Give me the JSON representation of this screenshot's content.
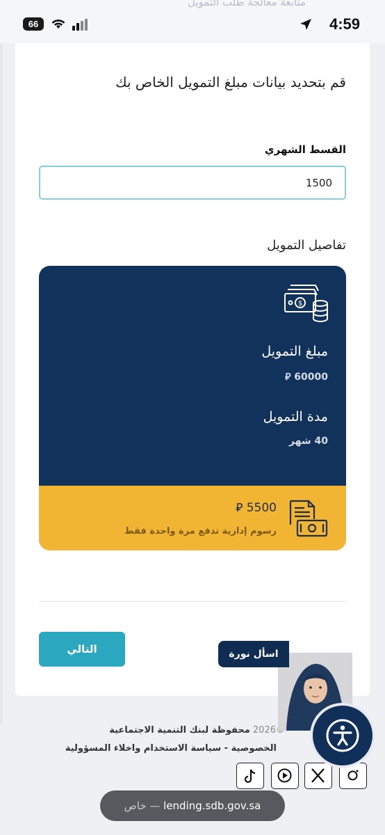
{
  "status_bar": {
    "time": "4:59",
    "battery": "66",
    "ghost_text": "متابعة معالجة طلب التمويل"
  },
  "form": {
    "heading": "قم بتحديد بيانات مبلغ التمويل الخاص بك",
    "installment_label": "القسط الشهري",
    "installment_value": "1500"
  },
  "details": {
    "title": "تفاصيل التمويل",
    "amount_label": "مبلغ التمويل",
    "amount_value": "60000 ⃁",
    "duration_label": "مدة التمويل",
    "duration_value": "40 شهر",
    "fee_amount": "5500 ⃁",
    "fee_note": "رسوم إدارية تدفع مرة واحدة فقط"
  },
  "actions": {
    "next_label": "التالي",
    "ask_label": "اسأل نورة"
  },
  "footer": {
    "copyright_year": "©2026",
    "rights_text": "محفوظة لبنك التنمية الاجتماعية",
    "links_text": "الخصوصية - سياسة الاستخدام واخلاء المسؤولية"
  },
  "browser": {
    "url": "lending.sdb.gov.sa",
    "private_label": "— خاص"
  },
  "colors": {
    "panel_navy": "#11325a",
    "fee_yellow": "#f1b533",
    "next_teal": "#2ba7bf",
    "input_border": "#86d0dc"
  }
}
